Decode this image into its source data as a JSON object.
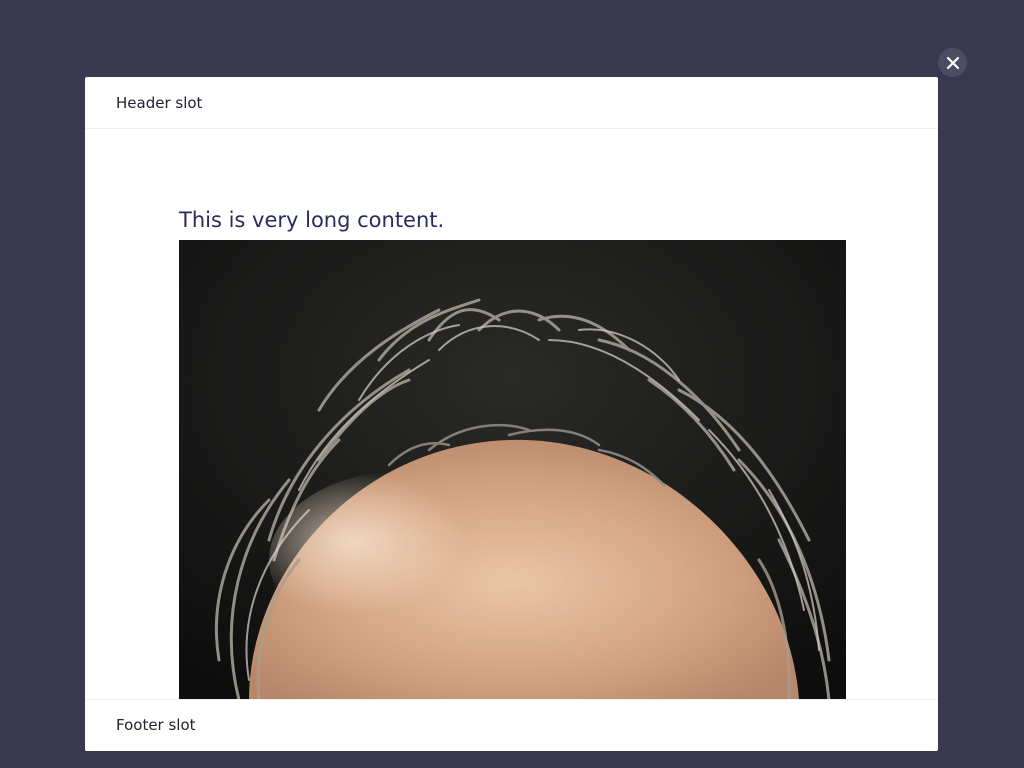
{
  "modal": {
    "header_text": "Header slot",
    "content_title": "This is very long content.",
    "footer_text": "Footer slot",
    "image": {
      "icon": "photo-bald-head",
      "alt": "Bald head with wild gray hair"
    },
    "close": {
      "icon": "close-icon"
    }
  },
  "colors": {
    "backdrop": "#383850",
    "modal_bg": "#ffffff",
    "title": "#2a2d5a",
    "close_bg": "#4c4c62"
  }
}
